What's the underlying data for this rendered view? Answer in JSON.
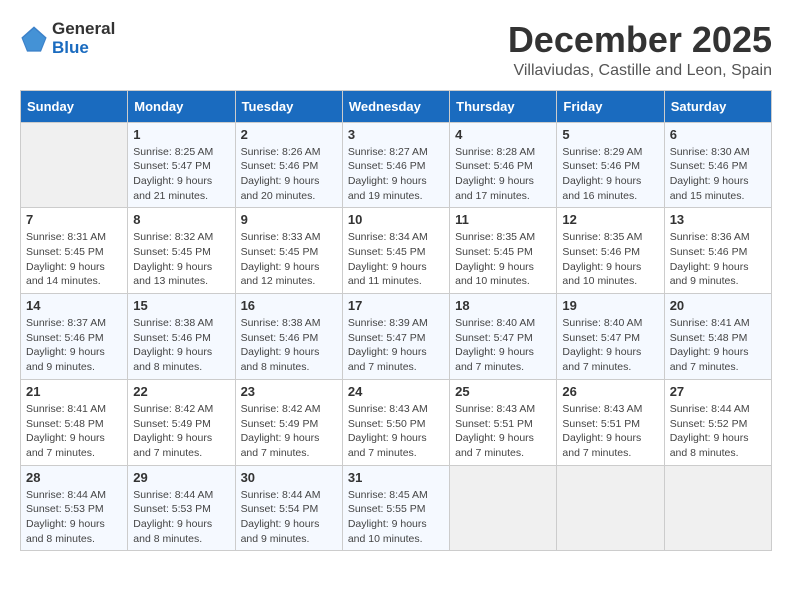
{
  "logo": {
    "text_general": "General",
    "text_blue": "Blue"
  },
  "title": "December 2025",
  "subtitle": "Villaviudas, Castille and Leon, Spain",
  "header_days": [
    "Sunday",
    "Monday",
    "Tuesday",
    "Wednesday",
    "Thursday",
    "Friday",
    "Saturday"
  ],
  "weeks": [
    [
      {
        "day": "",
        "info": ""
      },
      {
        "day": "1",
        "info": "Sunrise: 8:25 AM\nSunset: 5:47 PM\nDaylight: 9 hours\nand 21 minutes."
      },
      {
        "day": "2",
        "info": "Sunrise: 8:26 AM\nSunset: 5:46 PM\nDaylight: 9 hours\nand 20 minutes."
      },
      {
        "day": "3",
        "info": "Sunrise: 8:27 AM\nSunset: 5:46 PM\nDaylight: 9 hours\nand 19 minutes."
      },
      {
        "day": "4",
        "info": "Sunrise: 8:28 AM\nSunset: 5:46 PM\nDaylight: 9 hours\nand 17 minutes."
      },
      {
        "day": "5",
        "info": "Sunrise: 8:29 AM\nSunset: 5:46 PM\nDaylight: 9 hours\nand 16 minutes."
      },
      {
        "day": "6",
        "info": "Sunrise: 8:30 AM\nSunset: 5:46 PM\nDaylight: 9 hours\nand 15 minutes."
      }
    ],
    [
      {
        "day": "7",
        "info": "Sunrise: 8:31 AM\nSunset: 5:45 PM\nDaylight: 9 hours\nand 14 minutes."
      },
      {
        "day": "8",
        "info": "Sunrise: 8:32 AM\nSunset: 5:45 PM\nDaylight: 9 hours\nand 13 minutes."
      },
      {
        "day": "9",
        "info": "Sunrise: 8:33 AM\nSunset: 5:45 PM\nDaylight: 9 hours\nand 12 minutes."
      },
      {
        "day": "10",
        "info": "Sunrise: 8:34 AM\nSunset: 5:45 PM\nDaylight: 9 hours\nand 11 minutes."
      },
      {
        "day": "11",
        "info": "Sunrise: 8:35 AM\nSunset: 5:45 PM\nDaylight: 9 hours\nand 10 minutes."
      },
      {
        "day": "12",
        "info": "Sunrise: 8:35 AM\nSunset: 5:46 PM\nDaylight: 9 hours\nand 10 minutes."
      },
      {
        "day": "13",
        "info": "Sunrise: 8:36 AM\nSunset: 5:46 PM\nDaylight: 9 hours\nand 9 minutes."
      }
    ],
    [
      {
        "day": "14",
        "info": "Sunrise: 8:37 AM\nSunset: 5:46 PM\nDaylight: 9 hours\nand 9 minutes."
      },
      {
        "day": "15",
        "info": "Sunrise: 8:38 AM\nSunset: 5:46 PM\nDaylight: 9 hours\nand 8 minutes."
      },
      {
        "day": "16",
        "info": "Sunrise: 8:38 AM\nSunset: 5:46 PM\nDaylight: 9 hours\nand 8 minutes."
      },
      {
        "day": "17",
        "info": "Sunrise: 8:39 AM\nSunset: 5:47 PM\nDaylight: 9 hours\nand 7 minutes."
      },
      {
        "day": "18",
        "info": "Sunrise: 8:40 AM\nSunset: 5:47 PM\nDaylight: 9 hours\nand 7 minutes."
      },
      {
        "day": "19",
        "info": "Sunrise: 8:40 AM\nSunset: 5:47 PM\nDaylight: 9 hours\nand 7 minutes."
      },
      {
        "day": "20",
        "info": "Sunrise: 8:41 AM\nSunset: 5:48 PM\nDaylight: 9 hours\nand 7 minutes."
      }
    ],
    [
      {
        "day": "21",
        "info": "Sunrise: 8:41 AM\nSunset: 5:48 PM\nDaylight: 9 hours\nand 7 minutes."
      },
      {
        "day": "22",
        "info": "Sunrise: 8:42 AM\nSunset: 5:49 PM\nDaylight: 9 hours\nand 7 minutes."
      },
      {
        "day": "23",
        "info": "Sunrise: 8:42 AM\nSunset: 5:49 PM\nDaylight: 9 hours\nand 7 minutes."
      },
      {
        "day": "24",
        "info": "Sunrise: 8:43 AM\nSunset: 5:50 PM\nDaylight: 9 hours\nand 7 minutes."
      },
      {
        "day": "25",
        "info": "Sunrise: 8:43 AM\nSunset: 5:51 PM\nDaylight: 9 hours\nand 7 minutes."
      },
      {
        "day": "26",
        "info": "Sunrise: 8:43 AM\nSunset: 5:51 PM\nDaylight: 9 hours\nand 7 minutes."
      },
      {
        "day": "27",
        "info": "Sunrise: 8:44 AM\nSunset: 5:52 PM\nDaylight: 9 hours\nand 8 minutes."
      }
    ],
    [
      {
        "day": "28",
        "info": "Sunrise: 8:44 AM\nSunset: 5:53 PM\nDaylight: 9 hours\nand 8 minutes."
      },
      {
        "day": "29",
        "info": "Sunrise: 8:44 AM\nSunset: 5:53 PM\nDaylight: 9 hours\nand 8 minutes."
      },
      {
        "day": "30",
        "info": "Sunrise: 8:44 AM\nSunset: 5:54 PM\nDaylight: 9 hours\nand 9 minutes."
      },
      {
        "day": "31",
        "info": "Sunrise: 8:45 AM\nSunset: 5:55 PM\nDaylight: 9 hours\nand 10 minutes."
      },
      {
        "day": "",
        "info": ""
      },
      {
        "day": "",
        "info": ""
      },
      {
        "day": "",
        "info": ""
      }
    ]
  ]
}
